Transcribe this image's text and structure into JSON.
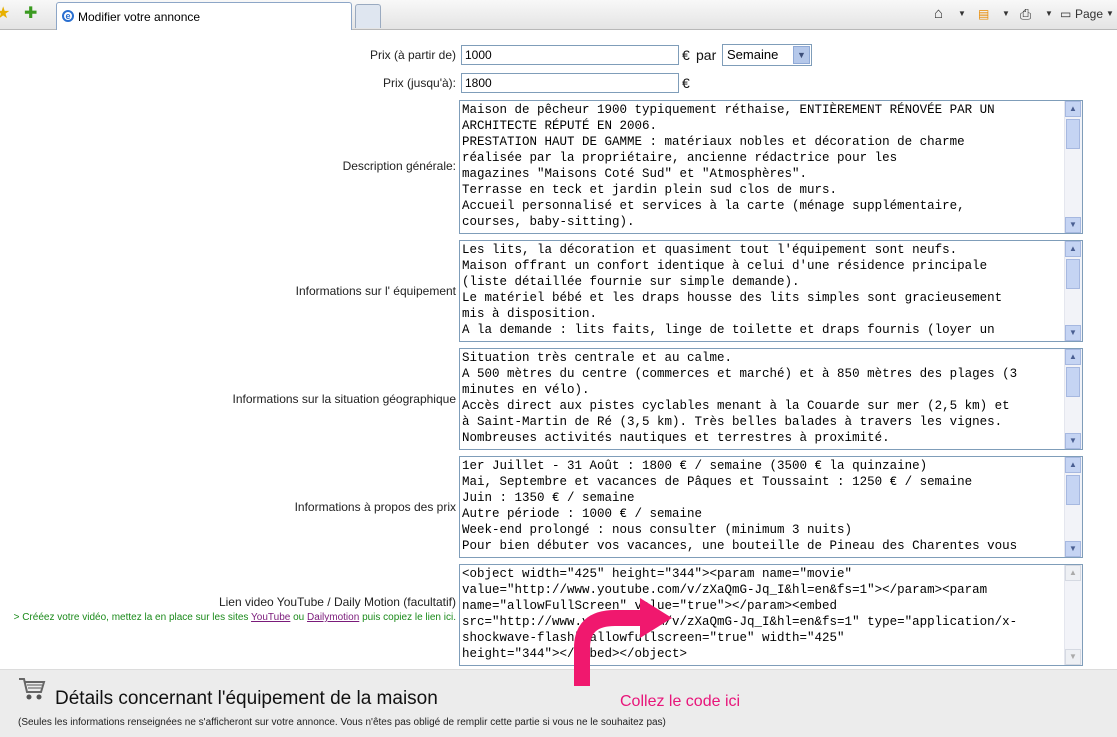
{
  "browser": {
    "tab_title": "Modifier votre annonce",
    "page_menu": "Page"
  },
  "form": {
    "price_from": {
      "label": "Prix (à partir de)",
      "value": "1000",
      "currency": "€",
      "per": "par",
      "period": "Semaine"
    },
    "price_to": {
      "label": "Prix (jusqu'à):",
      "value": "1800",
      "currency": "€"
    },
    "description": {
      "label": "Description générale:",
      "value": "Maison de pêcheur 1900 typiquement réthaise, ENTIÈREMENT RÉNOVÉE PAR UN\nARCHITECTE RÉPUTÉ EN 2006.\nPRESTATION HAUT DE GAMME : matériaux nobles et décoration de charme\nréalisée par la propriétaire, ancienne rédactrice pour les\nmagazines \"Maisons Coté Sud\" et \"Atmosphères\".\nTerrasse en teck et jardin plein sud clos de murs.\nAccueil personnalisé et services à la carte (ménage supplémentaire,\ncourses, baby-sitting)."
    },
    "equipment": {
      "label": "Informations sur l' équipement",
      "value": "Les lits, la décoration et quasiment tout l'équipement sont neufs.\nMaison offrant un confort identique à celui d'une résidence principale\n(liste détaillée fournie sur simple demande).\nLe matériel bébé et les draps housse des lits simples sont gracieusement\nmis à disposition.\nA la demande : lits faits, linge de toilette et draps fournis (loyer un"
    },
    "location": {
      "label": "Informations sur la situation géographique",
      "value": "Situation très centrale et au calme.\nA 500 mètres du centre (commerces et marché) et à 850 mètres des plages (3\nminutes en vélo).\nAccès direct aux pistes cyclables menant à la Couarde sur mer (2,5 km) et\nà Saint-Martin de Ré (3,5 km). Très belles balades à travers les vignes.\nNombreuses activités nautiques et terrestres à proximité."
    },
    "prices_info": {
      "label": "Informations à propos des prix",
      "value": "1er Juillet - 31 Août : 1800 € / semaine (3500 € la quinzaine)\nMai, Septembre et vacances de Pâques et Toussaint : 1250 € / semaine\nJuin : 1350 € / semaine\nAutre période : 1000 € / semaine\nWeek-end prolongé : nous consulter (minimum 3 nuits)\nPour bien débuter vos vacances, une bouteille de Pineau des Charentes vous"
    },
    "video": {
      "label": "Lien video YouTube / Daily Motion (facultatif)",
      "help_prefix": "> Crééez votre vidéo, mettez la en place sur les sites",
      "help_youtube": "YouTube",
      "help_or": "ou",
      "help_dailymotion": "Dailymotion",
      "help_suffix": "puis copiez le lien ici.",
      "value": "<object width=\"425\" height=\"344\"><param name=\"movie\"\nvalue=\"http://www.youtube.com/v/zXaQmG-Jq_I&hl=en&fs=1\"></param><param\nname=\"allowFullScreen\" value=\"true\"></param><embed\nsrc=\"http://www.youtube.com/v/zXaQmG-Jq_I&hl=en&fs=1\" type=\"application/x-\nshockwave-flash\" allowfullscreen=\"true\" width=\"425\"\nheight=\"344\"></embed></object>"
    }
  },
  "section": {
    "title": "Détails concernant l'équipement de la maison",
    "note": "(Seules les informations renseignées ne s'afficheront sur votre annonce. Vous n'êtes pas obligé de remplir cette partie si vous ne le souhaitez pas)"
  },
  "annotation": {
    "text": "Collez le code ici",
    "color": "#e8157a"
  }
}
